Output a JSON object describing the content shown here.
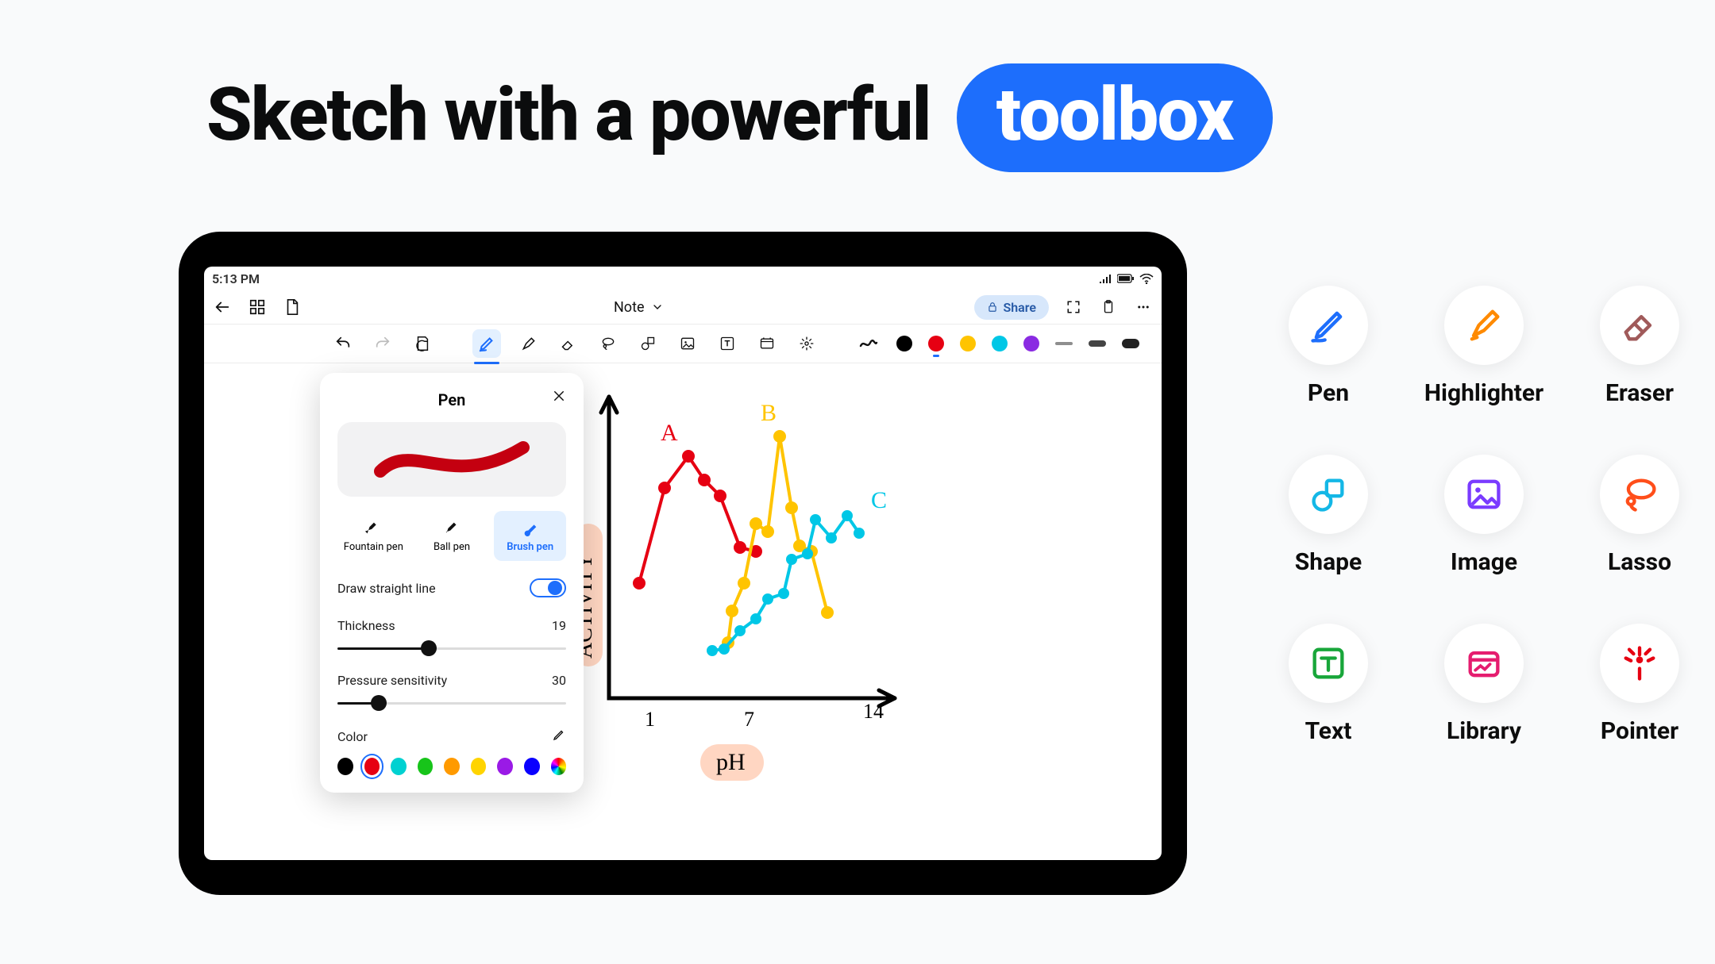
{
  "headline": {
    "prefix": "Sketch with a powerful",
    "pill": "toolbox"
  },
  "status": {
    "time": "5:13 PM"
  },
  "topbar": {
    "title": "Note",
    "share_label": "Share"
  },
  "toolbar": {
    "colors": [
      "#000000",
      "#e60012",
      "#ffc400",
      "#00c7e6",
      "#8a2be2"
    ]
  },
  "popover": {
    "title": "Pen",
    "pen_types": [
      {
        "label": "Fountain pen",
        "selected": false
      },
      {
        "label": "Ball pen",
        "selected": false
      },
      {
        "label": "Brush pen",
        "selected": true
      }
    ],
    "straight_line_label": "Draw straight line",
    "straight_line_on": true,
    "thickness_label": "Thickness",
    "thickness_value": "19",
    "thickness_percent": 40,
    "pressure_label": "Pressure sensitivity",
    "pressure_value": "30",
    "pressure_percent": 18,
    "color_label": "Color",
    "swatches": [
      "#000000",
      "#e60012",
      "#00d1d1",
      "#17c41a",
      "#ff9a00",
      "#ffd400",
      "#9a1ae6",
      "#0a00ff"
    ]
  },
  "canvas_labels": {
    "x": "pH",
    "y": "ACTIVITY",
    "ticks": [
      "1",
      "7",
      "14"
    ],
    "series": [
      "A",
      "B",
      "C"
    ]
  },
  "toolbox": {
    "items": [
      {
        "label": "Pen",
        "icon": "pen-icon",
        "color": "#1d6efc"
      },
      {
        "label": "Highlighter",
        "icon": "highlighter-icon",
        "color": "#ff8a00"
      },
      {
        "label": "Eraser",
        "icon": "eraser-icon",
        "color": "#a05a5a"
      },
      {
        "label": "Shape",
        "icon": "shape-icon",
        "color": "#14b7e6"
      },
      {
        "label": "Image",
        "icon": "image-icon",
        "color": "#7a3bff"
      },
      {
        "label": "Lasso",
        "icon": "lasso-icon",
        "color": "#ff4e1a"
      },
      {
        "label": "Text",
        "icon": "text-icon",
        "color": "#18a63a"
      },
      {
        "label": "Library",
        "icon": "library-icon",
        "color": "#e51d6f"
      },
      {
        "label": "Pointer",
        "icon": "pointer-icon",
        "color": "#e60012"
      }
    ]
  },
  "chart_data": {
    "type": "line",
    "title": "",
    "xlabel": "pH",
    "ylabel": "ACTIVITY",
    "xlim": [
      1,
      14
    ],
    "ylim": [
      0,
      10
    ],
    "series": [
      {
        "name": "A",
        "x": [
          1.5,
          3.0,
          4.0,
          4.8,
          5.5,
          6.5,
          7.2
        ],
        "y": [
          3.4,
          6.8,
          7.8,
          7.0,
          6.5,
          4.7,
          4.5
        ]
      },
      {
        "name": "B",
        "x": [
          5.8,
          6.0,
          6.5,
          7.0,
          7.5,
          8.0,
          8.5,
          8.8,
          9.3,
          10.0
        ],
        "y": [
          1.6,
          2.5,
          3.5,
          5.5,
          5.3,
          8.6,
          6.2,
          4.8,
          4.7,
          2.6
        ]
      },
      {
        "name": "C",
        "x": [
          6.0,
          6.6,
          7.3,
          8.0,
          8.5,
          9.2,
          9.6,
          10.2,
          10.5,
          11.2,
          11.8,
          12.4
        ],
        "y": [
          1.3,
          1.4,
          2.1,
          2.5,
          3.3,
          3.5,
          4.8,
          5.0,
          6.3,
          5.6,
          6.4,
          5.8
        ]
      }
    ]
  }
}
